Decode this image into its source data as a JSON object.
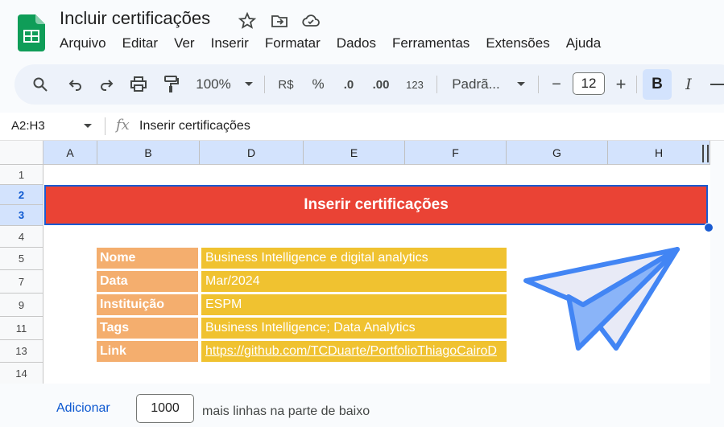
{
  "app": {
    "doc_title": "Incluir certificações",
    "menu": [
      "Arquivo",
      "Editar",
      "Ver",
      "Inserir",
      "Formatar",
      "Dados",
      "Ferramentas",
      "Extensões",
      "Ajuda"
    ]
  },
  "toolbar": {
    "zoom": "100%",
    "currency": "R$",
    "percent": "%",
    "decrease_decimal": ".0",
    "increase_decimal": ".00",
    "number_format": "123",
    "font": "Padrã...",
    "minus": "−",
    "font_size": "12",
    "plus": "+",
    "bold": "B",
    "italic": "I"
  },
  "formula_bar": {
    "name_box": "A2:H3",
    "fx": "fx",
    "formula": "Inserir certificações"
  },
  "columns": [
    "A",
    "B",
    "D",
    "E",
    "F",
    "G",
    "H"
  ],
  "rows": [
    "1",
    "2",
    "3",
    "4",
    "5",
    "7",
    "9",
    "11",
    "13",
    "14"
  ],
  "sheet": {
    "banner": "Inserir certificações",
    "fields": [
      {
        "label": "Nome",
        "value": "Business Intelligence e digital analytics"
      },
      {
        "label": "Data",
        "value": "Mar/2024"
      },
      {
        "label": "Instituição",
        "value": "ESPM"
      },
      {
        "label": "Tags",
        "value": "Business Intelligence; Data Analytics"
      },
      {
        "label": "Link",
        "value": "https://github.com/TCDuarte/PortfolioThiagoCairoD"
      }
    ]
  },
  "bottom": {
    "add_label": "Adicionar",
    "rows_value": "1000",
    "rows_text": "mais linhas na parte de baixo"
  },
  "colors": {
    "banner": "#ea4335",
    "label_bg": "#f4ae6e",
    "value_bg": "#f0c230",
    "selection": "#1a5bd1"
  },
  "icons": [
    "sheets-logo-icon",
    "star-icon",
    "move-folder-icon",
    "cloud-saved-icon",
    "search-icon",
    "undo-icon",
    "redo-icon",
    "print-icon",
    "paint-format-icon",
    "chevron-down-icon",
    "paper-plane-icon"
  ]
}
